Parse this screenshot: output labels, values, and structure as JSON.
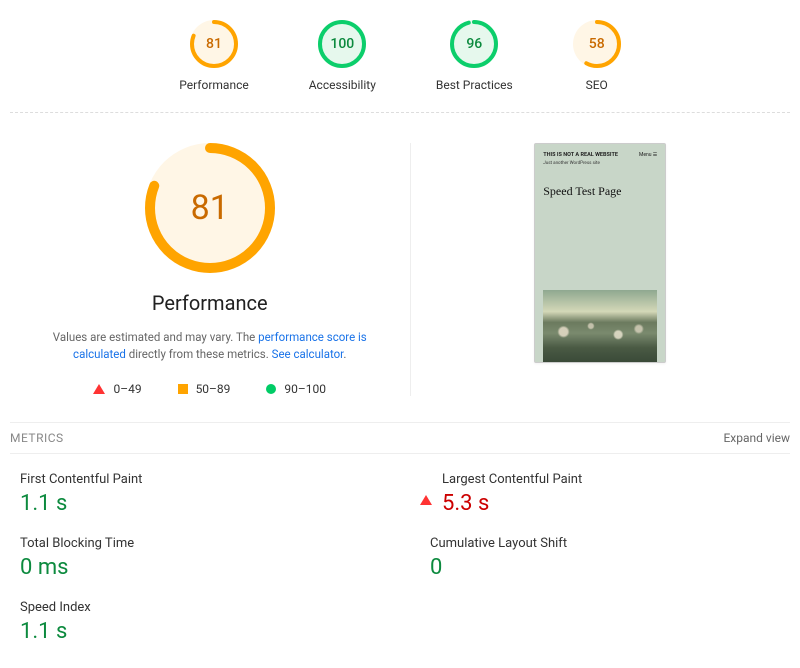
{
  "colors": {
    "good": "#0cce6b",
    "average": "#ffa400",
    "poor": "#ff3333",
    "good_text": "#0c8a3e",
    "poor_text": "#cc0000"
  },
  "scores": [
    {
      "label": "Performance",
      "value": 81,
      "status": "average"
    },
    {
      "label": "Accessibility",
      "value": 100,
      "status": "good"
    },
    {
      "label": "Best Practices",
      "value": 96,
      "status": "good"
    },
    {
      "label": "SEO",
      "value": 58,
      "status": "average"
    }
  ],
  "gauge": {
    "value": 81,
    "title": "Performance",
    "status": "average"
  },
  "description": {
    "pre": "Values are estimated and may vary. The ",
    "link1": "performance score is calculated",
    "mid": " directly from these metrics. ",
    "link2": "See calculator"
  },
  "legend": [
    {
      "shape": "triangle",
      "label": "0–49"
    },
    {
      "shape": "square",
      "label": "50–89"
    },
    {
      "shape": "circle",
      "label": "90–100"
    }
  ],
  "preview": {
    "site_title": "THIS IS NOT A REAL WEBSITE",
    "tagline": "Just another WordPress site",
    "menu": "Menu ☰",
    "heading": "Speed Test Page"
  },
  "metrics_section": {
    "title": "METRICS",
    "expand": "Expand view"
  },
  "metrics": [
    {
      "name": "First Contentful Paint",
      "value": "1.1 s",
      "status": "good"
    },
    {
      "name": "Largest Contentful Paint",
      "value": "5.3 s",
      "status": "poor"
    },
    {
      "name": "Total Blocking Time",
      "value": "0 ms",
      "status": "good"
    },
    {
      "name": "Cumulative Layout Shift",
      "value": "0",
      "status": "good"
    },
    {
      "name": "Speed Index",
      "value": "1.1 s",
      "status": "good"
    }
  ]
}
